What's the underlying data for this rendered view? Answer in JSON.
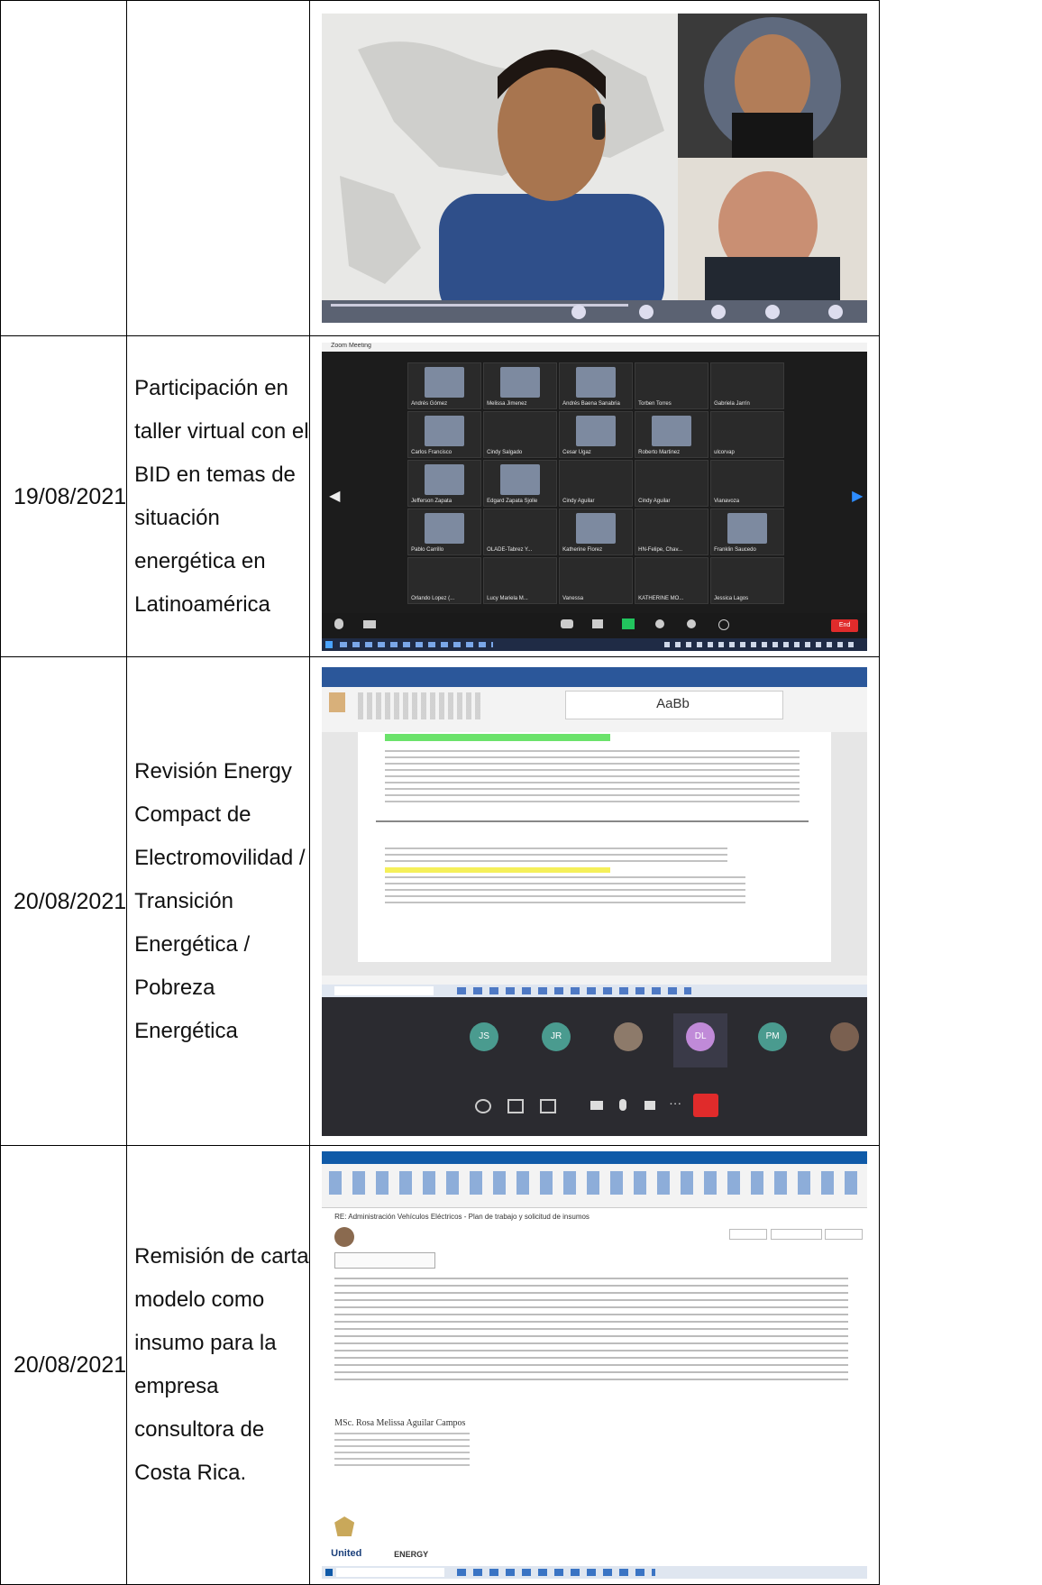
{
  "rows": [
    {
      "date": "",
      "description": "",
      "screenshot": {
        "kind": "video-call-speaker",
        "participants": [
          "presenter-with-headset",
          "man-black-shirt",
          "man-with-suit"
        ]
      }
    },
    {
      "date": "19/08/2021",
      "description": "Participación en taller virtual con el BID en temas de situación energética en Latinoamérica",
      "screenshot": {
        "kind": "zoom-gallery",
        "window_title": "Zoom Meeting",
        "tiles": [
          "Andrés Gómez",
          "Melissa Jimenez",
          "Andrés Baena Sanabria",
          "Torben Torres",
          "Gabriela Jarrín",
          "Carlos Francisco",
          "Cindy Salgado",
          "Cesar Ugaz",
          "Roberto Martinez",
          "ulcorvap",
          "Jefferson Zapata",
          "Edgard Zapata Sjolle",
          "Cindy Aguilar",
          "Cindy Aguilar",
          "Vianavoza",
          "Pablo Carrillo",
          "OLADE-Tabrez Y...",
          "Katherine Florez",
          "HN-Felipe, Chav...",
          "Franklin Saucedo",
          "Orlando Lopez (...",
          "Lucy Mariela M...",
          "Vanessa",
          "KATHERINE MO...",
          "Jessica Lagos"
        ],
        "end_button": "End"
      }
    },
    {
      "date": "20/08/2021",
      "description": "Revisión Energy Compact de Electromovilidad / Transición Energética / Pobreza Energética",
      "screenshot": {
        "kind": "word-plus-teams",
        "styles_preview": "AaBb",
        "teams_initials": [
          "JS",
          "JR",
          "",
          "DL",
          "PM",
          "",
          ""
        ]
      }
    },
    {
      "date": "20/08/2021",
      "description": "Remisión de carta modelo como insumo para la empresa consultora de Costa Rica.",
      "screenshot": {
        "kind": "outlook-message",
        "subject": "RE: Administración Vehículos Eléctricos - Plan de trabajo y solicitud de insumos",
        "signature_name": "MSc. Rosa Melissa Aguilar Campos",
        "logos": [
          "United",
          "ENERGY"
        ]
      }
    }
  ],
  "colors": {
    "zoom_bg": "#1c1c1c",
    "teams_bg": "#2b2b30",
    "word_blue": "#2b579a",
    "outlook_blue": "#0f5aa8",
    "end_red": "#e02b2b"
  }
}
